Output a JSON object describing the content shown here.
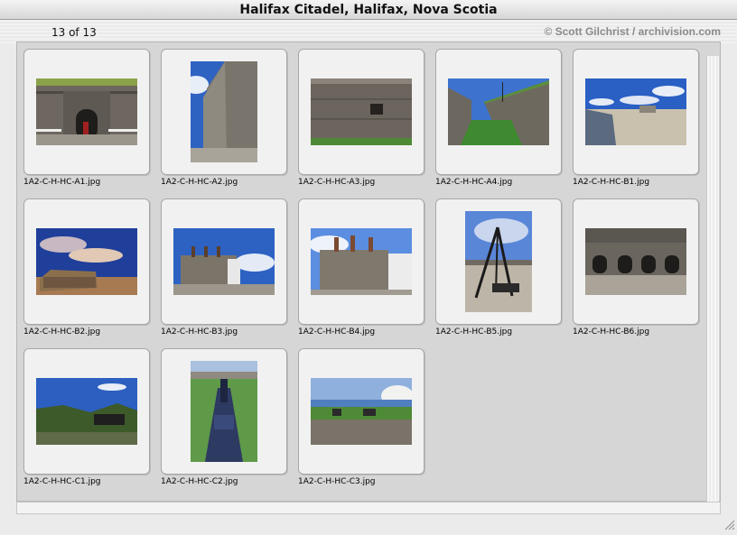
{
  "window": {
    "title": "Halifax Citadel, Halifax, Nova Scotia"
  },
  "header": {
    "counter": "13 of 13",
    "credit": "© Scott Gilchrist / archivision.com"
  },
  "thumbnails": [
    {
      "filename": "1A2-C-H-HC-A1.jpg",
      "orientation": "landscape"
    },
    {
      "filename": "1A2-C-H-HC-A2.jpg",
      "orientation": "portrait"
    },
    {
      "filename": "1A2-C-H-HC-A3.jpg",
      "orientation": "landscape"
    },
    {
      "filename": "1A2-C-H-HC-A4.jpg",
      "orientation": "landscape"
    },
    {
      "filename": "1A2-C-H-HC-B1.jpg",
      "orientation": "landscape"
    },
    {
      "filename": "1A2-C-H-HC-B2.jpg",
      "orientation": "landscape"
    },
    {
      "filename": "1A2-C-H-HC-B3.jpg",
      "orientation": "landscape"
    },
    {
      "filename": "1A2-C-H-HC-B4.jpg",
      "orientation": "landscape"
    },
    {
      "filename": "1A2-C-H-HC-B5.jpg",
      "orientation": "portrait"
    },
    {
      "filename": "1A2-C-H-HC-B6.jpg",
      "orientation": "landscape"
    },
    {
      "filename": "1A2-C-H-HC-C1.jpg",
      "orientation": "landscape"
    },
    {
      "filename": "1A2-C-H-HC-C2.jpg",
      "orientation": "portrait"
    },
    {
      "filename": "1A2-C-H-HC-C3.jpg",
      "orientation": "landscape"
    }
  ],
  "colors": {
    "pane": "#d6d6d6",
    "stone": "#6f6a62",
    "sky": "#3f6fc4",
    "grass": "#4f8a3a"
  }
}
